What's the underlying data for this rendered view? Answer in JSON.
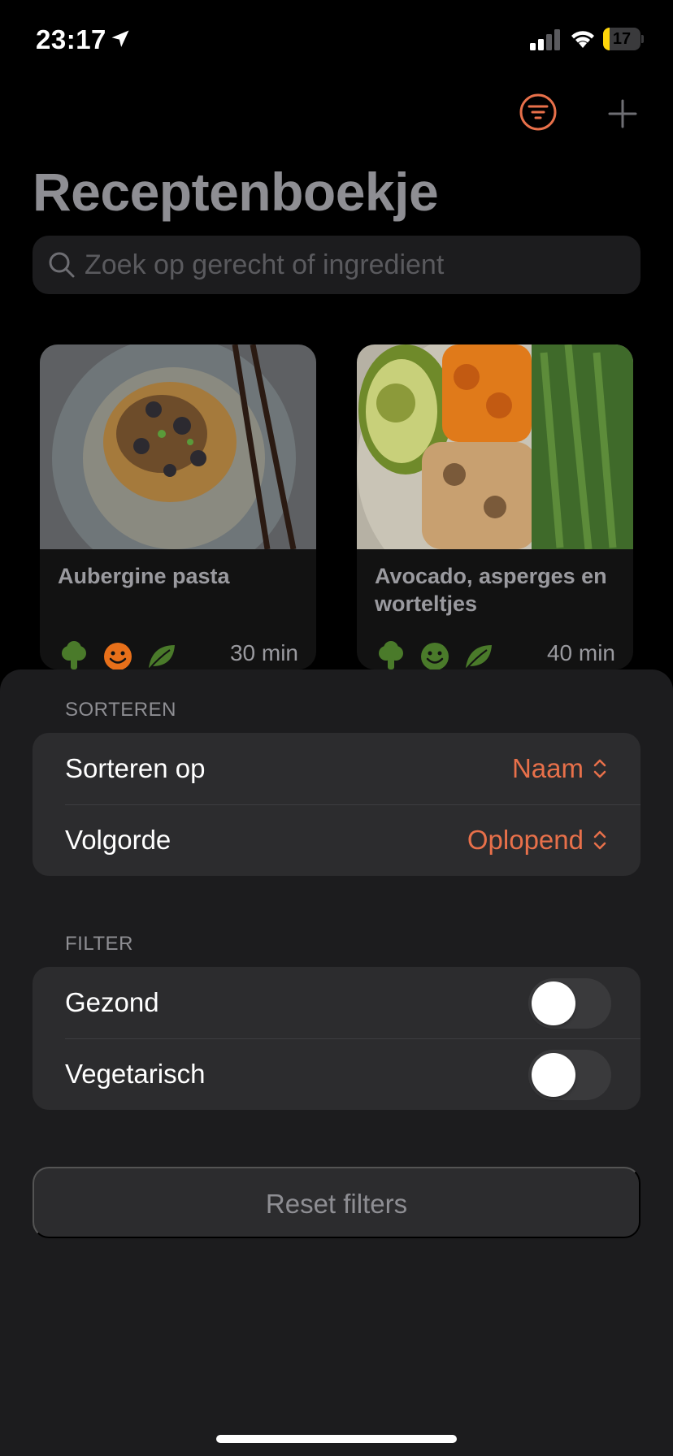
{
  "status_bar": {
    "time": "23:17",
    "battery": "17",
    "battery_level": 0.17
  },
  "nav": {
    "title": "Receptenboekje"
  },
  "search": {
    "placeholder": "Zoek op gerecht of ingredient"
  },
  "recipes": [
    {
      "title": "Aubergine pasta",
      "time": "30 min",
      "icons": [
        "broccoli-icon",
        "smiley-icon",
        "leaf-icon"
      ],
      "icon_colors": [
        "#4a7a2a",
        "#e8701a",
        "#4a7a2a"
      ]
    },
    {
      "title": "Avocado, asperges en worteltjes",
      "time": "40 min",
      "icons": [
        "broccoli-icon",
        "smiley-icon",
        "leaf-icon"
      ],
      "icon_colors": [
        "#4a7a2a",
        "#4a7a2a",
        "#4a7a2a"
      ]
    }
  ],
  "sheet": {
    "sort_header": "SORTEREN",
    "sort_by_label": "Sorteren op",
    "sort_by_value": "Naam",
    "order_label": "Volgorde",
    "order_value": "Oplopend",
    "filter_header": "FILTER",
    "healthy_label": "Gezond",
    "healthy_on": false,
    "vegetarian_label": "Vegetarisch",
    "vegetarian_on": false,
    "reset_label": "Reset filters"
  },
  "colors": {
    "accent": "#e8704a",
    "background": "#000000",
    "sheet": "#1c1c1e",
    "group": "#2c2c2e"
  }
}
